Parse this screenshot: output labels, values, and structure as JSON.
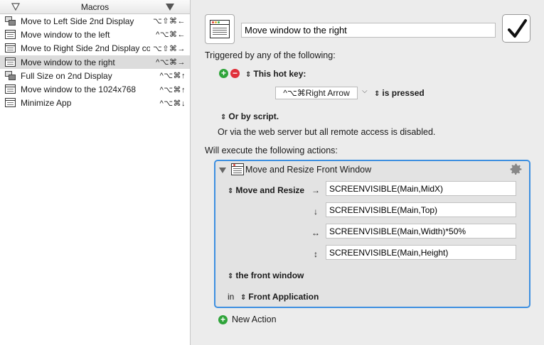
{
  "sidebar": {
    "header": "Macros",
    "macros": [
      {
        "name": "Move to Left Side 2nd Display",
        "keys": "⌥⇧⌘←",
        "icon": "stacked-windows-icon",
        "selected": false
      },
      {
        "name": "Move window to the left",
        "keys": "^⌥⌘←",
        "icon": "window-icon",
        "selected": false
      },
      {
        "name": "Move to Right Side 2nd Display co...",
        "keys": "⌥⇧⌘→",
        "icon": "window-icon",
        "selected": false
      },
      {
        "name": "Move window to the right",
        "keys": "^⌥⌘→",
        "icon": "window-icon",
        "selected": true
      },
      {
        "name": "Full Size on 2nd Display",
        "keys": "^⌥⌘↑",
        "icon": "stacked-windows-icon",
        "selected": false
      },
      {
        "name": "Move window to the 1024x768",
        "keys": "^⌥⌘↑",
        "icon": "window-icon",
        "selected": false
      },
      {
        "name": "Minimize App",
        "keys": "^⌥⌘↓",
        "icon": "window-icon",
        "selected": false
      }
    ]
  },
  "editor": {
    "macro_name": "Move window to the right",
    "triggered_label": "Triggered by any of the following:",
    "hotkey_label": "This hot key:",
    "hotkey_value": "^⌥⌘Right Arrow",
    "hotkey_state": "is pressed",
    "script_label": "Or by script.",
    "web_server_text": "Or via the web server but all remote access is disabled.",
    "execute_label": "Will execute the following actions:",
    "action": {
      "title": "Move and Resize Front Window",
      "mode_label": "Move and Resize",
      "fields": [
        {
          "arrow": "→",
          "value": "SCREENVISIBLE(Main,MidX)"
        },
        {
          "arrow": "↓",
          "value": "SCREENVISIBLE(Main,Top)"
        },
        {
          "arrow": "↔",
          "value": "SCREENVISIBLE(Main,Width)*50%"
        },
        {
          "arrow": "↕",
          "value": "SCREENVISIBLE(Main,Height)"
        }
      ],
      "target_label": "the front window",
      "in_label": "in",
      "app_label": "Front Application"
    },
    "new_action_label": "New Action"
  },
  "colors": {
    "accent": "#3d8fe0",
    "add": "#2fa43a",
    "remove": "#e0303a",
    "selection": "#dcdcdc"
  }
}
